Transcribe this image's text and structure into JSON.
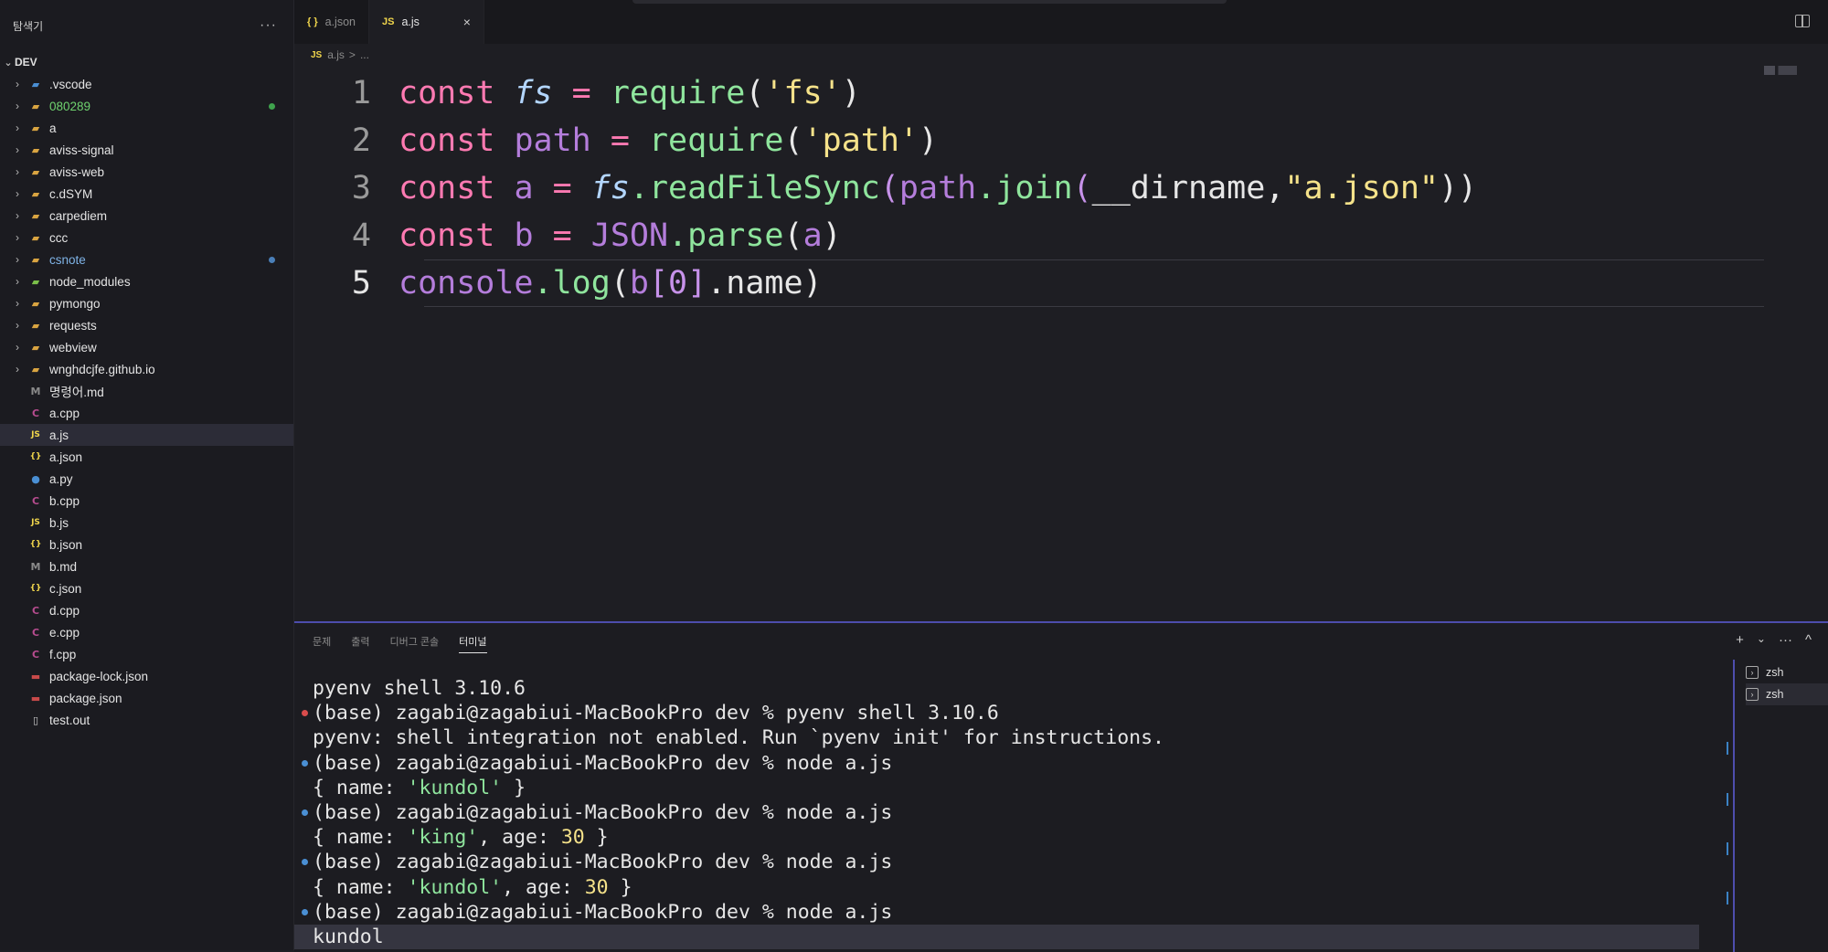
{
  "sidebar": {
    "title": "탐색기",
    "more_label": "···",
    "root_label": "DEV",
    "items": [
      {
        "label": ".vscode",
        "folder": true,
        "icon": "vscode-folder-icon",
        "color": "#e4e4e4"
      },
      {
        "label": "080289",
        "folder": true,
        "icon": "folder-icon",
        "color": "#6fd36f",
        "dot": "#3fa34d"
      },
      {
        "label": "a",
        "folder": true,
        "icon": "folder-icon",
        "color": "#e4e4e4"
      },
      {
        "label": "aviss-signal",
        "folder": true,
        "icon": "folder-icon",
        "color": "#e4e4e4"
      },
      {
        "label": "aviss-web",
        "folder": true,
        "icon": "folder-icon",
        "color": "#e4e4e4"
      },
      {
        "label": "c.dSYM",
        "folder": true,
        "icon": "folder-icon",
        "color": "#e4e4e4"
      },
      {
        "label": "carpediem",
        "folder": true,
        "icon": "folder-icon",
        "color": "#e4e4e4"
      },
      {
        "label": "ccc",
        "folder": true,
        "icon": "folder-icon",
        "color": "#e4e4e4"
      },
      {
        "label": "csnote",
        "folder": true,
        "icon": "folder-icon",
        "color": "#7fb3e6",
        "dot": "#4a7fb8"
      },
      {
        "label": "node_modules",
        "folder": true,
        "icon": "node-folder-icon",
        "color": "#e4e4e4"
      },
      {
        "label": "pymongo",
        "folder": true,
        "icon": "folder-icon",
        "color": "#e4e4e4"
      },
      {
        "label": "requests",
        "folder": true,
        "icon": "folder-icon",
        "color": "#e4e4e4"
      },
      {
        "label": "webview",
        "folder": true,
        "icon": "folder-icon",
        "color": "#e4e4e4"
      },
      {
        "label": "wnghdcjfe.github.io",
        "folder": true,
        "icon": "folder-icon",
        "color": "#e4e4e4"
      },
      {
        "label": "명령어.md",
        "folder": false,
        "icon": "markdown-file-icon",
        "color": "#e4e4e4"
      },
      {
        "label": "a.cpp",
        "folder": false,
        "icon": "cpp-file-icon",
        "color": "#e4e4e4"
      },
      {
        "label": "a.js",
        "folder": false,
        "icon": "js-file-icon",
        "color": "#e4e4e4",
        "selected": true
      },
      {
        "label": "a.json",
        "folder": false,
        "icon": "json-file-icon",
        "color": "#e4e4e4"
      },
      {
        "label": "a.py",
        "folder": false,
        "icon": "python-file-icon",
        "color": "#e4e4e4"
      },
      {
        "label": "b.cpp",
        "folder": false,
        "icon": "cpp-file-icon",
        "color": "#e4e4e4"
      },
      {
        "label": "b.js",
        "folder": false,
        "icon": "js-file-icon",
        "color": "#e4e4e4"
      },
      {
        "label": "b.json",
        "folder": false,
        "icon": "json-file-icon",
        "color": "#e4e4e4"
      },
      {
        "label": "b.md",
        "folder": false,
        "icon": "markdown-file-icon",
        "color": "#e4e4e4"
      },
      {
        "label": "c.json",
        "folder": false,
        "icon": "json-file-icon",
        "color": "#e4e4e4"
      },
      {
        "label": "d.cpp",
        "folder": false,
        "icon": "cpp-file-icon",
        "color": "#e4e4e4"
      },
      {
        "label": "e.cpp",
        "folder": false,
        "icon": "cpp-file-icon",
        "color": "#e4e4e4"
      },
      {
        "label": "f.cpp",
        "folder": false,
        "icon": "cpp-file-icon",
        "color": "#e4e4e4"
      },
      {
        "label": "package-lock.json",
        "folder": false,
        "icon": "npm-file-icon",
        "color": "#e4e4e4"
      },
      {
        "label": "package.json",
        "folder": false,
        "icon": "npm-file-icon",
        "color": "#e4e4e4"
      },
      {
        "label": "test.out",
        "folder": false,
        "icon": "file-icon",
        "color": "#e4e4e4"
      }
    ]
  },
  "tabs": [
    {
      "label": "a.json",
      "icon": "{ }",
      "icon_name": "json-file-icon",
      "active": false
    },
    {
      "label": "a.js",
      "icon": "JS",
      "icon_name": "js-file-icon",
      "active": true,
      "close": "×"
    }
  ],
  "breadcrumb": {
    "icon": "JS",
    "file": "a.js",
    "sep": ">",
    "rest": "..."
  },
  "code": {
    "line_numbers": [
      "1",
      "2",
      "3",
      "4",
      "5"
    ],
    "l1": {
      "kw": "const",
      "name": "fs",
      "eq": "=",
      "fn": "require",
      "open": "(",
      "arg": "'fs'",
      "close": ")"
    },
    "l2": {
      "kw": "const",
      "name": "path",
      "eq": "=",
      "fn": "require",
      "open": "(",
      "arg": "'path'",
      "close": ")"
    },
    "l3": {
      "kw": "const",
      "name": "a",
      "eq": "=",
      "obj": "fs",
      "fn": ".readFileSync",
      "open": "(",
      "obj2": "path",
      "fn2": ".join",
      "open2": "(",
      "arg1": "__dirname",
      "comma": ",",
      "arg2": "\"a.json\"",
      "close": "))"
    },
    "l4": {
      "kw": "const",
      "name": "b",
      "eq": "=",
      "obj": "JSON",
      "fn": ".parse",
      "open": "(",
      "arg": "a",
      "close": ")"
    },
    "l5": {
      "obj": "console",
      "fn": ".log",
      "open": "(",
      "b": "b",
      "idx": "[0]",
      "prop": ".name",
      "close": ")"
    }
  },
  "panel": {
    "tabs": [
      {
        "label": "문제",
        "active": false
      },
      {
        "label": "출력",
        "active": false
      },
      {
        "label": "디버그 콘솔",
        "active": false
      },
      {
        "label": "터미널",
        "active": true
      }
    ],
    "actions": {
      "add": "+",
      "dropdown": "⌄",
      "more": "···",
      "maximize": "^"
    },
    "terminal_sessions": [
      {
        "label": "zsh",
        "active": false
      },
      {
        "label": "zsh",
        "active": true
      }
    ]
  },
  "terminal": {
    "lines": [
      {
        "text": "pyenv shell 3.10.6"
      },
      {
        "text": "(base) zagabi@zagabiui-MacBookPro dev % pyenv shell 3.10.6",
        "bullet": "#d94c4c"
      },
      {
        "text": "pyenv: shell integration not enabled. Run `pyenv init' for instructions."
      },
      {
        "text": "(base) zagabi@zagabiui-MacBookPro dev % node a.js",
        "bullet": "#4a8fd4"
      },
      {
        "pre": "{ name: ",
        "str": "'kundol'",
        "post": " }"
      },
      {
        "text": "(base) zagabi@zagabiui-MacBookPro dev % node a.js",
        "bullet": "#4a8fd4"
      },
      {
        "pre": "{ name: ",
        "str": "'king'",
        "mid": ", age: ",
        "num": "30",
        "post": " }"
      },
      {
        "text": "(base) zagabi@zagabiui-MacBookPro dev % node a.js",
        "bullet": "#4a8fd4"
      },
      {
        "pre": "{ name: ",
        "str": "'kundol'",
        "mid": ", age: ",
        "num": "30",
        "post": " }"
      },
      {
        "text": "(base) zagabi@zagabiui-MacBookPro dev % node a.js",
        "bullet": "#4a8fd4"
      },
      {
        "text": "kundol",
        "last": true
      }
    ]
  },
  "colors": {
    "accent": "#4d4dad",
    "selection": "#2c2c37"
  }
}
